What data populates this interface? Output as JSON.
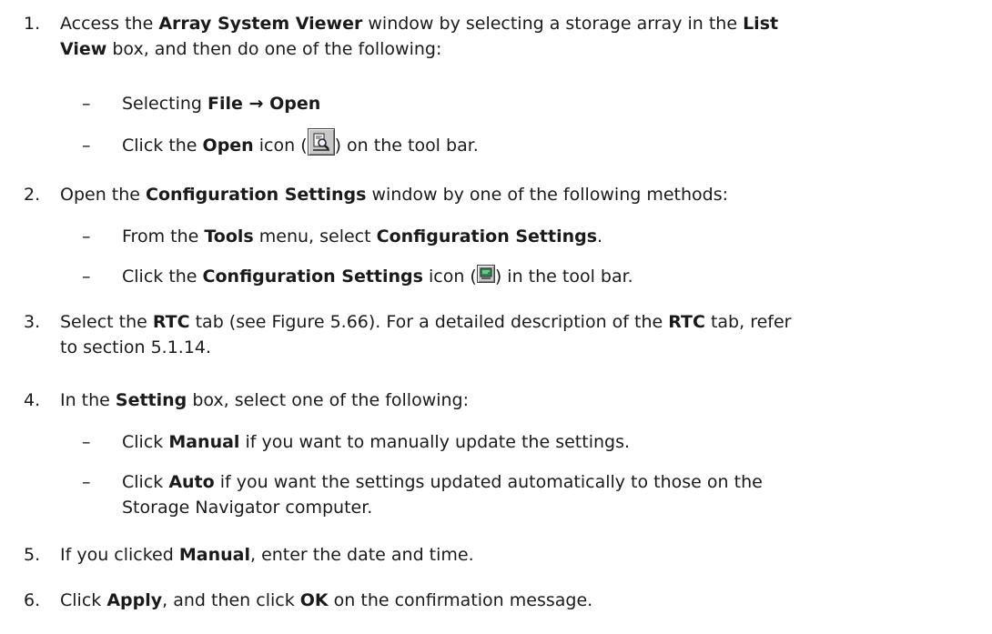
{
  "steps": [
    {
      "num": "1.",
      "line1_prefix": "Access the ",
      "line1_b1": "Array System Viewer",
      "line1_mid": " window by selecting a storage array in the ",
      "line1_b2": "List",
      "line2_b": "View",
      "line2_rest": " box, and then do one of the following:",
      "bullets": [
        {
          "prefix": "Selecting ",
          "b": "File → Open"
        },
        {
          "prefix": "Click the ",
          "b": "Open",
          "mid": " icon (",
          "icon": "search-document-icon",
          "suffix": ") on the tool bar."
        }
      ]
    },
    {
      "num": "2.",
      "prefix": "Open the ",
      "b": "Configuration Settings",
      "suffix": " window by one of the following methods:",
      "bullets": [
        {
          "prefix": "From the ",
          "b1": "Tools",
          "mid": " menu, select ",
          "b2": "Configuration Settings",
          "suffix": "."
        },
        {
          "prefix": "Click the ",
          "b": "Configuration Settings",
          "mid": " icon (",
          "icon": "config-settings-icon",
          "suffix": ") in the tool bar."
        }
      ]
    },
    {
      "num": "3.",
      "prefix": "Select the ",
      "b1": "RTC",
      "mid": " tab (see Figure 5.66). For a detailed description of the ",
      "b2": "RTC",
      "suffix1": " tab, refer",
      "line2": "to section 5.1.14."
    },
    {
      "num": "4.",
      "prefix": "In the ",
      "b": "Setting",
      "suffix": " box, select one of the following:",
      "bullets": [
        {
          "prefix": "Click ",
          "b": "Manual",
          "suffix": " if you want to manually update the settings."
        },
        {
          "prefix": "Click ",
          "b": "Auto",
          "suffix": " if you want the settings updated automatically to those on the",
          "line2": "Storage Navigator computer."
        }
      ]
    },
    {
      "num": "5.",
      "prefix": "If you clicked ",
      "b": "Manual",
      "suffix": ", enter the date and time."
    },
    {
      "num": "6.",
      "prefix": "Click ",
      "b1": "Apply",
      "mid": ", and then click ",
      "b2": "OK",
      "suffix": " on the confirmation message."
    }
  ],
  "dash_glyph": "–",
  "colors": {
    "text": "#1a1a1a",
    "icon_face": "#c8c8c8",
    "config_screen": "#2e8b57"
  }
}
